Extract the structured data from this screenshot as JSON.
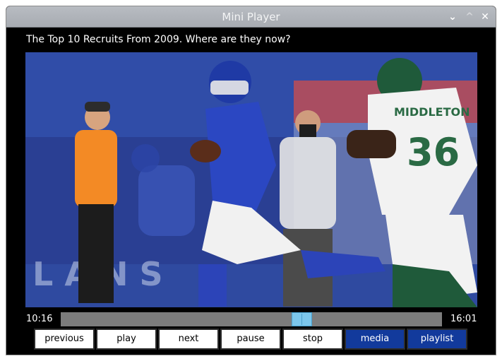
{
  "window": {
    "title": "Mini Player",
    "controls": {
      "minimize": "⌄",
      "maximize": "^",
      "close": "✕"
    }
  },
  "video": {
    "title": "The Top 10 Recruits From 2009. Where are they now?",
    "jersey_name": "MIDDLETON",
    "jersey_number": "36"
  },
  "playback": {
    "current_time": "10:16",
    "total_time": "16:01",
    "progress": 0.64
  },
  "buttons": {
    "previous": "previous",
    "play": "play",
    "next": "next",
    "pause": "pause",
    "stop": "stop",
    "media": "media",
    "playlist": "playlist"
  },
  "colors": {
    "accent_button": "#123a9c",
    "slider_thumb": "#7cc7ec",
    "background": "#000000"
  }
}
